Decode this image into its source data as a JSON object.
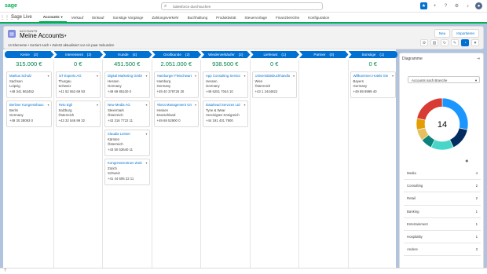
{
  "topbar": {
    "logo": "sage",
    "search_placeholder": "Salesforce durchsuchen",
    "icons": [
      "star-icon",
      "add-icon",
      "help-icon",
      "settings-icon",
      "bell-icon",
      "user-avatar"
    ]
  },
  "nav": {
    "app_name": "Sage Live",
    "tabs": [
      {
        "label": "Accounts",
        "active": true,
        "caret": true
      },
      {
        "label": "Verkauf",
        "caret": false
      },
      {
        "label": "Einkauf",
        "caret": false
      },
      {
        "label": "Sonstige Vorgänge",
        "caret": false
      },
      {
        "label": "Zahlungsverkehr",
        "caret": false
      },
      {
        "label": "Buchhaltung",
        "caret": false
      },
      {
        "label": "Produktivität",
        "caret": false
      },
      {
        "label": "Steuervorlage",
        "caret": false
      },
      {
        "label": "Finanzberichte",
        "caret": false
      },
      {
        "label": "Konfiguration",
        "caret": false
      }
    ]
  },
  "header": {
    "subtitle": "ACCOUNTS",
    "title": "Meine Accounts",
    "status": "14 Elemente • Sortiert nach • Zuletzt aktualisiert vor ein paar Sekunden",
    "buttons": [
      "Neu",
      "Importieren"
    ]
  },
  "stages": [
    {
      "label": "Keine",
      "count": "(2)",
      "total": "315.000 €",
      "cards": [
        {
          "name": "Markus Schulz",
          "l1": "Sachsen",
          "l2": "Leipzig",
          "l3": "+49 341 863452"
        },
        {
          "name": "Berliner Kongresshaus",
          "l1": "Berlin",
          "l2": "Germany",
          "l3": "+49 30 28093 0"
        }
      ]
    },
    {
      "label": "Interessent",
      "count": "(2)",
      "total": "0 €",
      "cards": [
        {
          "name": "IoT Experts AG",
          "l1": "Thurgau",
          "l2": "Schweiz",
          "l3": "+41 52 652 69 93"
        },
        {
          "name": "Reto Egli",
          "l1": "Salzburg",
          "l2": "Österreich",
          "l3": "+43 32 546 99 32"
        }
      ]
    },
    {
      "label": "Kunde",
      "count": "(4)",
      "total": "451.500 €",
      "cards": [
        {
          "name": "Digital Marketing GmbH",
          "l1": "Hessen",
          "l2": "Germany",
          "l3": "+49 69 85100 0"
        },
        {
          "name": "New Media AG",
          "l1": "Steiermark",
          "l2": "Österreich",
          "l3": "+43 316 7722 11"
        },
        {
          "name": "Claudia Leitner",
          "l1": "Kärnten",
          "l2": "Österreich",
          "l3": "+43 50 53640 11"
        },
        {
          "name": "Kongresszentrum Zürich",
          "l1": "Zürich",
          "l2": "Schweiz",
          "l3": "+41 44 605 22 11"
        }
      ]
    },
    {
      "label": "Großkunde",
      "count": "(2)",
      "total": "2.051.000 €",
      "cards": [
        {
          "name": "Hamburger Fleischwaren",
          "l1": "Hamburg",
          "l2": "Germany",
          "l3": "+49 40 378726 30"
        },
        {
          "name": "Altera Management GmbH",
          "l1": "Hessen",
          "l2": "Deutschland",
          "l3": "+49 69 52900 0"
        }
      ]
    },
    {
      "label": "Wiederverkäufer",
      "count": "(2)",
      "total": "938.500 €",
      "cards": [
        {
          "name": "App Consulting Services",
          "l1": "Hessen",
          "l2": "Germany",
          "l3": "+49 6251 7044 10"
        },
        {
          "name": "Datahead Services Ltd",
          "l1": "Tyne & Wear",
          "l2": "Vereinigtes Königreich",
          "l3": "+44 191 401 7900"
        }
      ]
    },
    {
      "label": "Lieferant",
      "count": "(1)",
      "total": "0 €",
      "cards": [
        {
          "name": "Universitätsbuchhandlung",
          "l1": "Wien",
          "l2": "Österreich",
          "l3": "+43 1 2444822"
        }
      ]
    },
    {
      "label": "Partner",
      "count": "(0)",
      "total": "",
      "cards": []
    },
    {
      "label": "Sonstige",
      "count": "(1)",
      "total": "0 €",
      "cards": [
        {
          "name": "Willkommen Hotels GmbH",
          "l1": "Bayern",
          "l2": "Germany",
          "l3": "+49 89 8999 40"
        }
      ]
    }
  ],
  "side": {
    "title": "Diagramme",
    "select": "Accounts nach Branche",
    "center": "14",
    "colors": {
      "blue": "#1b96ff",
      "navy": "#032d60",
      "teal": "#48d6c8",
      "cyan": "#0b827c",
      "yellow": "#e6c060",
      "orange": "#e39e05",
      "red": "#d83a34"
    },
    "segments": [
      {
        "label": "Media",
        "value": 4,
        "color": "#1b96ff"
      },
      {
        "label": "Consulting",
        "value": 2,
        "color": "#032d60"
      },
      {
        "label": "Retail",
        "value": 2,
        "color": "#48d6c8"
      },
      {
        "label": "Banking",
        "value": 1,
        "color": "#0b827c"
      },
      {
        "label": "Entertainment",
        "value": 1,
        "color": "#e6c060"
      },
      {
        "label": "Hospitality",
        "value": 1,
        "color": "#e39e05"
      },
      {
        "label": "Andere",
        "value": 3,
        "color": "#d83a34"
      }
    ],
    "legend": [
      {
        "label": "Media",
        "value": "4"
      },
      {
        "label": "Consulting",
        "value": "2"
      },
      {
        "label": "Retail",
        "value": "2"
      },
      {
        "label": "Banking",
        "value": "1"
      },
      {
        "label": "Entertainment",
        "value": "1"
      },
      {
        "label": "Hospitality",
        "value": "1"
      },
      {
        "label": "Andere",
        "value": "3"
      }
    ]
  }
}
